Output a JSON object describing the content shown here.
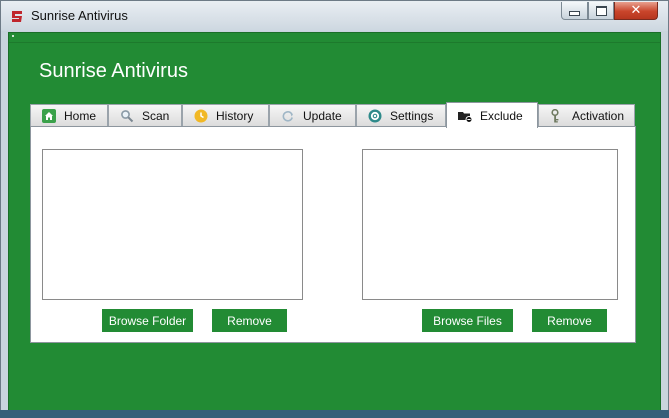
{
  "window": {
    "title": "Sunrise Antivirus",
    "controls": {
      "minimize_icon": "minimize-icon",
      "maximize_icon": "maximize-icon",
      "close_glyph": "✕"
    }
  },
  "app": {
    "heading": "Sunrise Antivirus"
  },
  "tabs": [
    {
      "label": "Home",
      "icon": "home-icon"
    },
    {
      "label": "Scan",
      "icon": "search-icon"
    },
    {
      "label": "History",
      "icon": "history-icon"
    },
    {
      "label": "Update",
      "icon": "update-icon"
    },
    {
      "label": "Settings",
      "icon": "gear-icon"
    },
    {
      "label": "Exclude",
      "icon": "folder-remove-icon",
      "active": true
    },
    {
      "label": "Activation",
      "icon": "key-icon"
    }
  ],
  "exclude": {
    "folders": {
      "items": [],
      "browse_label": "Browse Folder",
      "remove_label": "Remove"
    },
    "files": {
      "items": [],
      "browse_label": "Browse Files",
      "remove_label": "Remove"
    }
  },
  "colors": {
    "accent": "#228b34",
    "title_text": "#ffffff",
    "close_button": "#c9452b"
  }
}
